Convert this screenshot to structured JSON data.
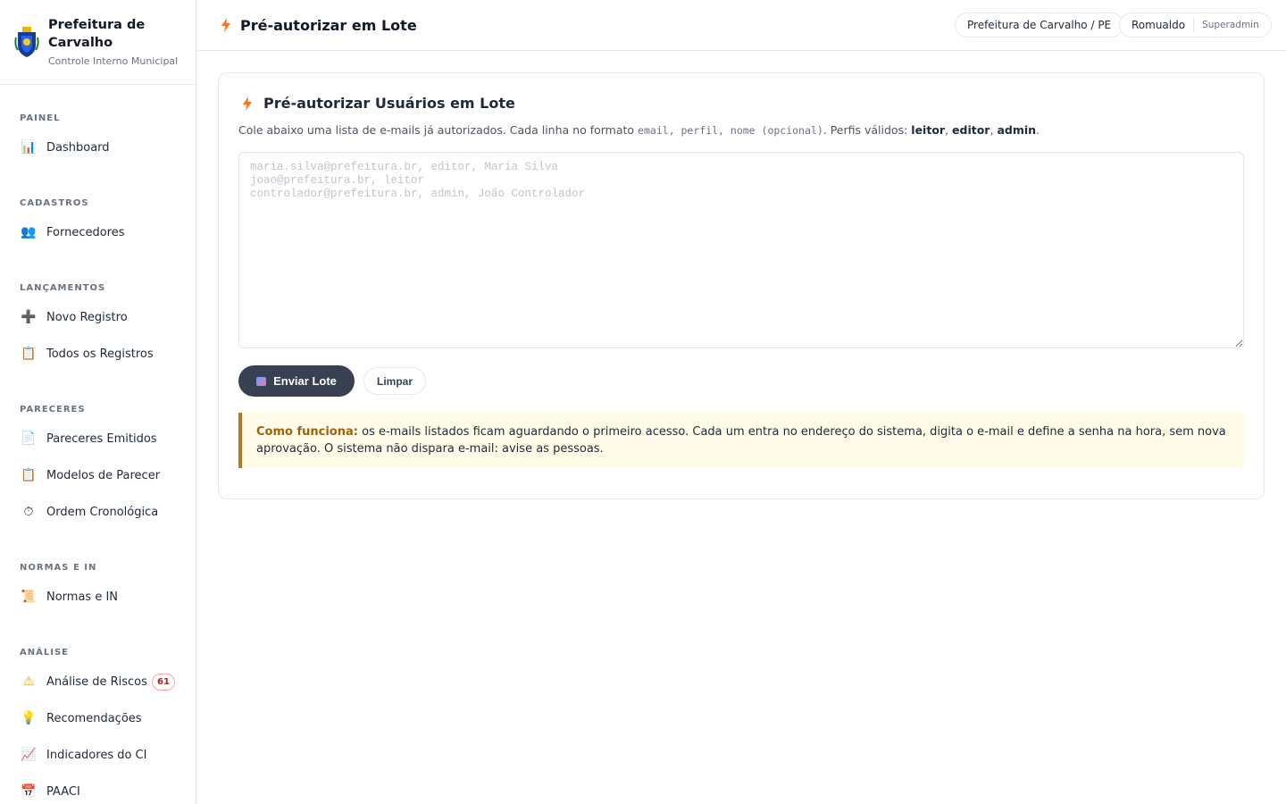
{
  "brand": {
    "title": "Prefeitura de Carvalho",
    "subtitle": "Controle Interno Municipal"
  },
  "sidebar": {
    "sections": [
      {
        "label": "PAINEL"
      },
      {
        "label": "CADASTROS"
      },
      {
        "label": "LANÇAMENTOS"
      },
      {
        "label": "PARECERES"
      },
      {
        "label": "NORMAS E IN"
      },
      {
        "label": "ANÁLISE"
      }
    ],
    "items": [
      {
        "label": "Dashboard",
        "icon": "bar-chart-icon",
        "glyph": "📊"
      },
      {
        "label": "Fornecedores",
        "icon": "people-icon",
        "glyph": "👥"
      },
      {
        "label": "Novo Registro",
        "icon": "plus-icon",
        "glyph": "➕"
      },
      {
        "label": "Todos os Registros",
        "icon": "clipboard-icon",
        "glyph": "📋"
      },
      {
        "label": "Pareceres Emitidos",
        "icon": "document-icon",
        "glyph": "📄"
      },
      {
        "label": "Modelos de Parecer",
        "icon": "clipboard-icon",
        "glyph": "📋"
      },
      {
        "label": "Ordem Cronológica",
        "icon": "stopwatch-icon",
        "glyph": "⏱"
      },
      {
        "label": "Normas e IN",
        "icon": "scroll-icon",
        "glyph": "📜"
      },
      {
        "label": "Análise de Riscos",
        "icon": "warning-icon",
        "glyph": "⚠",
        "badge": "61"
      },
      {
        "label": "Recomendações",
        "icon": "lightbulb-icon",
        "glyph": "💡"
      },
      {
        "label": "Indicadores do CI",
        "icon": "trend-chart-icon",
        "glyph": "📈"
      },
      {
        "label": "PAACI",
        "icon": "calendar-icon",
        "glyph": "📅"
      }
    ]
  },
  "header": {
    "title": "Pré-autorizar em Lote",
    "org": "Prefeitura de Carvalho / PE",
    "user": "Romualdo",
    "role": "Superadmin"
  },
  "card": {
    "title": "Pré-autorizar Usuários em Lote",
    "desc_prefix": "Cole abaixo uma lista de e-mails já autorizados. Cada linha no formato",
    "format_code": "email, perfil, nome (opcional)",
    "desc_profiles": ". Perfis válidos:",
    "profile_1": "leitor",
    "profile_2": "editor",
    "profile_3": "admin",
    "textarea_value": "",
    "textarea_placeholder": "maria.silva@prefeitura.br, editor, Maria Silva\njoao@prefeitura.br, leitor\ncontrolador@prefeitura.br, admin, João Controlador",
    "submit_label": "Enviar Lote",
    "clear_label": "Limpar",
    "info_label": "Como funciona:",
    "info_text": "os e-mails listados ficam aguardando o primeiro acesso. Cada um entra no endereço do sistema, digita o e-mail e define a senha na hora, sem nova aprovação. O sistema não dispara e-mail: avise as pessoas."
  },
  "colors": {
    "accent_dark": "#374151",
    "bolt_orange": "#f97316",
    "info_bg": "#fefce8",
    "info_border": "#b7791f",
    "badge_red": "#b91c1c"
  }
}
